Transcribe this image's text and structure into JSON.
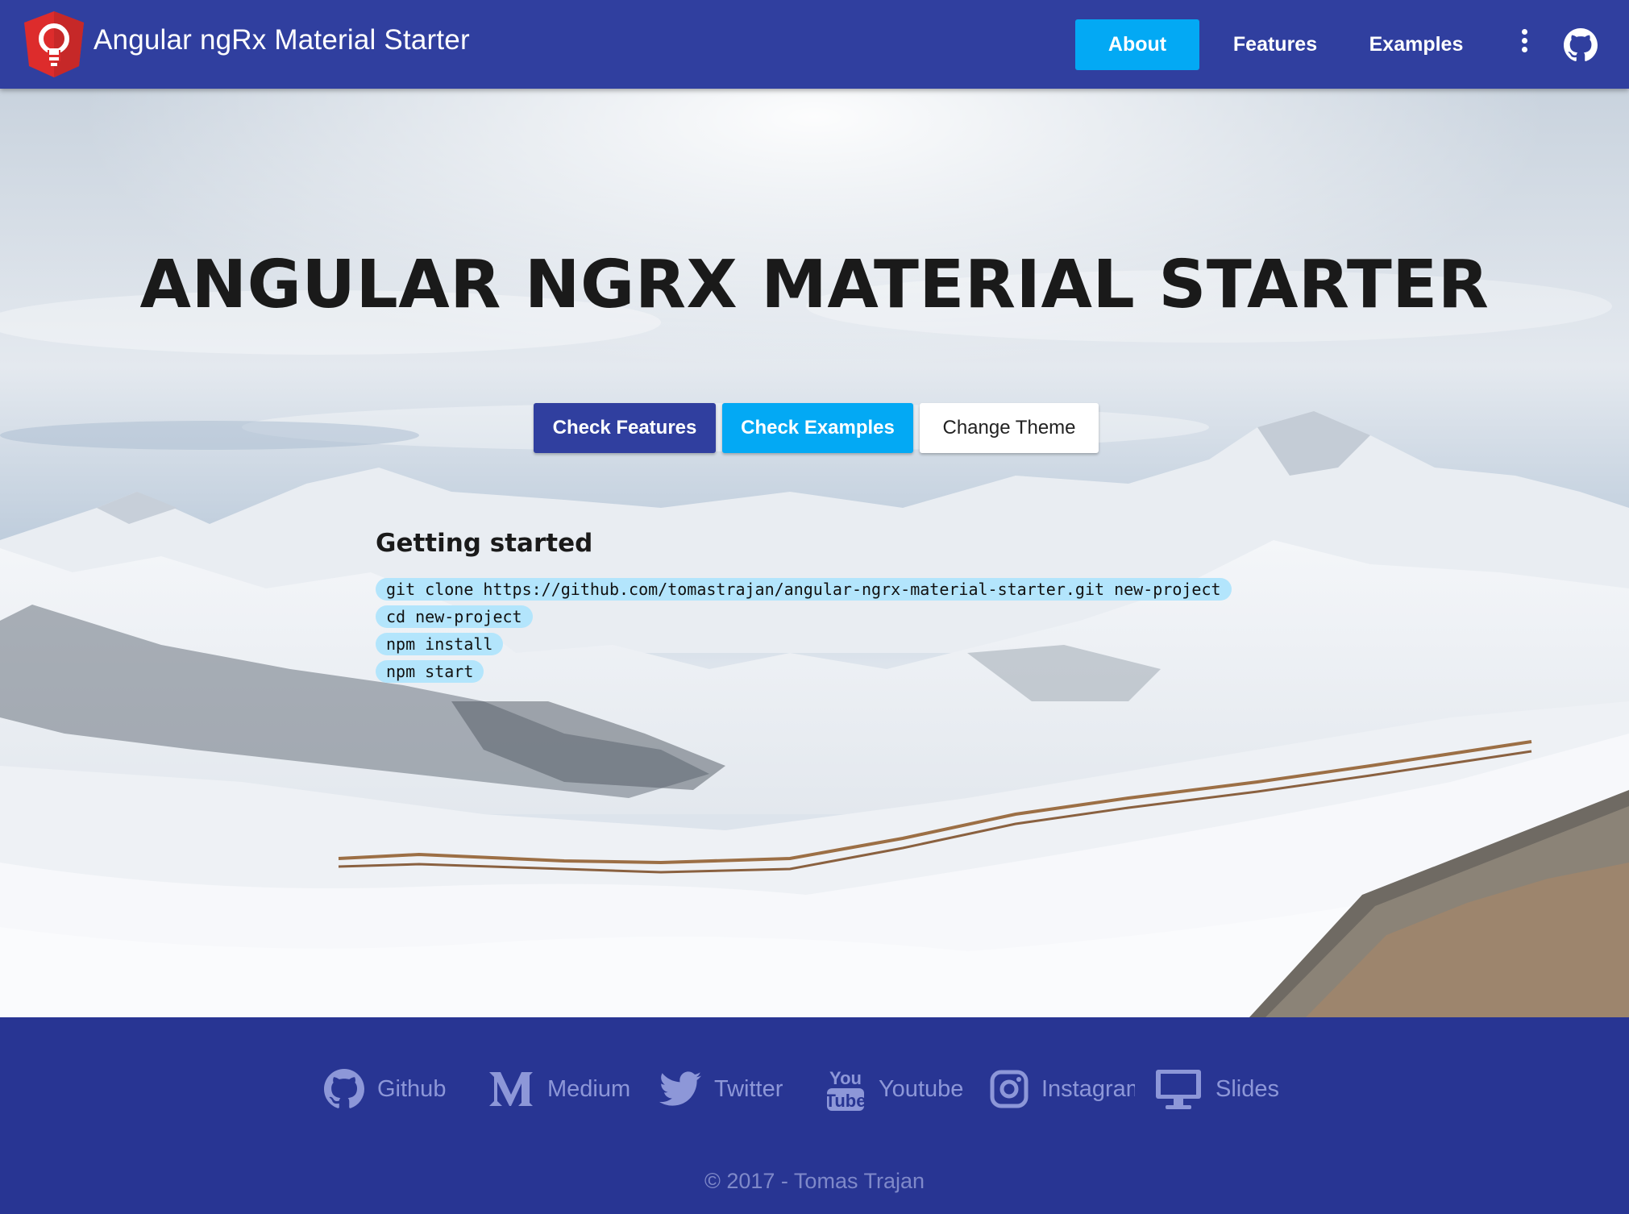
{
  "colors": {
    "primary": "#303f9f",
    "accent": "#03a9f4",
    "footer_bg": "#283593",
    "code_bg": "#b3e5fc",
    "logo": "#dd2c2c"
  },
  "toolbar": {
    "logo_icon": "lightbulb-shield-icon",
    "title": "Angular ngRx Material Starter",
    "nav": [
      {
        "label": "About",
        "active": true
      },
      {
        "label": "Features",
        "active": false
      },
      {
        "label": "Examples",
        "active": false
      }
    ],
    "menu_icon": "more-vert-icon",
    "github_icon": "github-icon"
  },
  "hero": {
    "title": "ANGULAR NGRX MATERIAL STARTER",
    "buttons": {
      "features": "Check Features",
      "examples": "Check Examples",
      "theme": "Change Theme"
    },
    "getting_started": {
      "title": "Getting started",
      "commands": [
        "git clone https://github.com/tomastrajan/angular-ngrx-material-starter.git new-project",
        "cd new-project",
        "npm install",
        "npm start"
      ]
    }
  },
  "footer": {
    "links": [
      {
        "label": "Github",
        "icon": "github-icon"
      },
      {
        "label": "Medium",
        "icon": "medium-icon"
      },
      {
        "label": "Twitter",
        "icon": "twitter-icon"
      },
      {
        "label": "Youtube",
        "icon": "youtube-icon"
      },
      {
        "label": "Instagram",
        "icon": "instagram-icon"
      },
      {
        "label": "Slides",
        "icon": "monitor-icon"
      }
    ],
    "copyright": "© 2017 - Tomas Trajan"
  }
}
